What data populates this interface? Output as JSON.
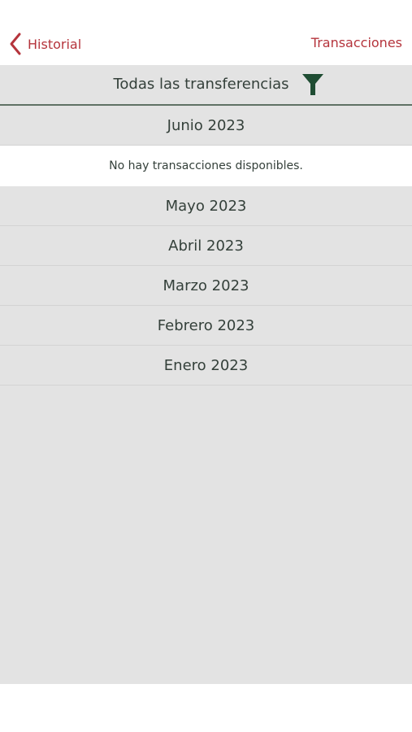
{
  "nav": {
    "back_label": "Historial",
    "title": "Transacciones"
  },
  "filter": {
    "label": "Todas las transferencias",
    "icon": "filter-icon"
  },
  "months": [
    {
      "label": "Junio 2023",
      "empty_message": "No hay transacciones disponibles."
    },
    {
      "label": "Mayo 2023"
    },
    {
      "label": "Abril 2023"
    },
    {
      "label": "Marzo 2023"
    },
    {
      "label": "Febrero 2023"
    },
    {
      "label": "Enero 2023"
    }
  ],
  "colors": {
    "accent": "#b5343c",
    "filter_icon": "#1f4d33",
    "list_background": "#e3e3e3",
    "text": "#34403a"
  }
}
